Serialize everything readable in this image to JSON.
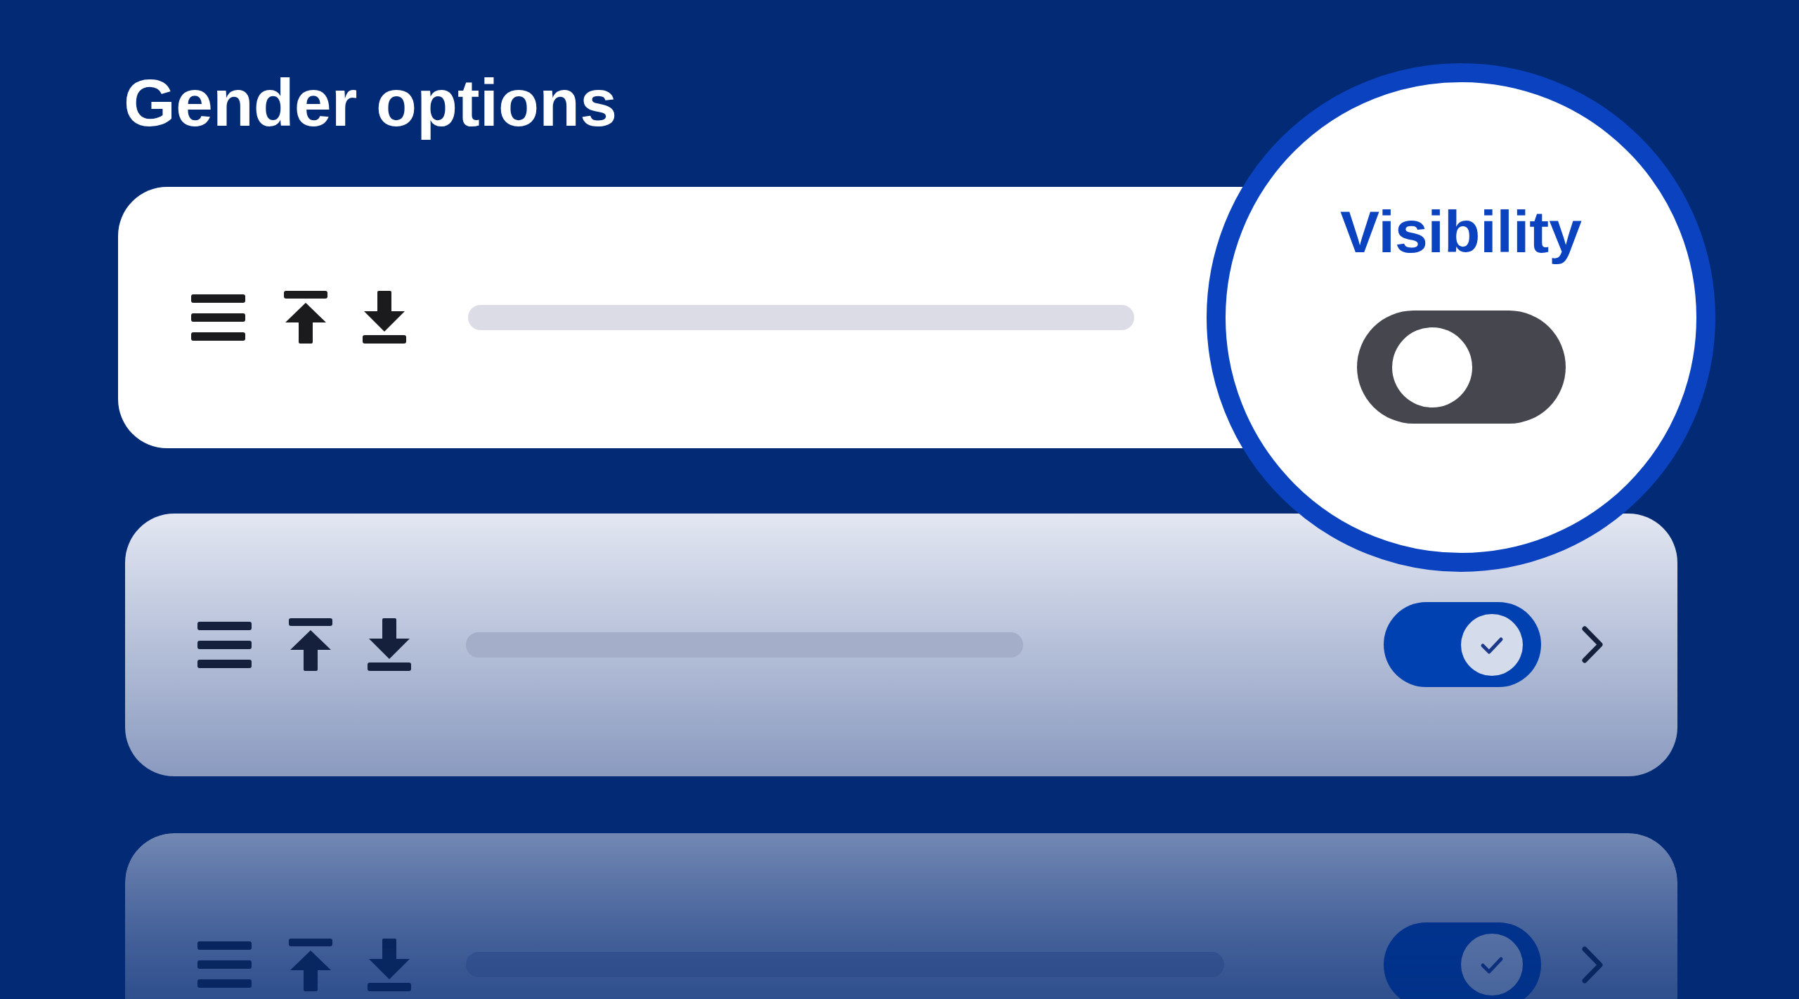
{
  "title": "Gender options",
  "rows": [
    {
      "selected": true
    },
    {
      "selected": false,
      "on": true
    },
    {
      "selected": false,
      "on": true
    }
  ],
  "magnifier": {
    "label": "Visibility",
    "on": false
  }
}
